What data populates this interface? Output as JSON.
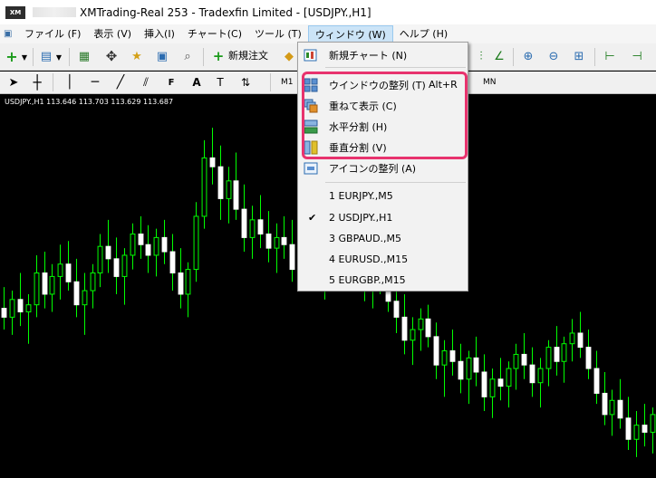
{
  "titlebar": {
    "logo_text": "XM",
    "title": "XMTrading-Real 253 - Tradexfin Limited - [USDJPY.,H1]"
  },
  "menubar": {
    "items": [
      {
        "label": "ファイル (F)"
      },
      {
        "label": "表示 (V)"
      },
      {
        "label": "挿入(I)"
      },
      {
        "label": "チャート(C)"
      },
      {
        "label": "ツール (T)"
      },
      {
        "label": "ウィンドウ (W)"
      },
      {
        "label": "ヘルプ (H)"
      }
    ]
  },
  "toolbar": {
    "new_order_label": "新規注文",
    "timeframes": [
      "M1",
      "MN"
    ]
  },
  "chart": {
    "info": "USDJPY.,H1  113.646 113.703 113.629 113.687",
    "bull_color": "#00ff00",
    "bear_color": "#ffffff",
    "candles": [
      {
        "o": 113.1,
        "h": 113.22,
        "l": 112.98,
        "c": 113.05
      },
      {
        "o": 113.05,
        "h": 113.2,
        "l": 112.95,
        "c": 113.15
      },
      {
        "o": 113.15,
        "h": 113.3,
        "l": 113.0,
        "c": 113.08
      },
      {
        "o": 113.08,
        "h": 113.18,
        "l": 112.9,
        "c": 113.12
      },
      {
        "o": 113.12,
        "h": 113.4,
        "l": 113.05,
        "c": 113.3
      },
      {
        "o": 113.3,
        "h": 113.42,
        "l": 113.1,
        "c": 113.18
      },
      {
        "o": 113.18,
        "h": 113.35,
        "l": 113.08,
        "c": 113.28
      },
      {
        "o": 113.28,
        "h": 113.46,
        "l": 113.15,
        "c": 113.35
      },
      {
        "o": 113.35,
        "h": 113.48,
        "l": 113.2,
        "c": 113.25
      },
      {
        "o": 113.25,
        "h": 113.38,
        "l": 113.05,
        "c": 113.12
      },
      {
        "o": 113.12,
        "h": 113.3,
        "l": 112.95,
        "c": 113.2
      },
      {
        "o": 113.2,
        "h": 113.35,
        "l": 113.1,
        "c": 113.3
      },
      {
        "o": 113.3,
        "h": 113.52,
        "l": 113.22,
        "c": 113.45
      },
      {
        "o": 113.45,
        "h": 113.6,
        "l": 113.3,
        "c": 113.38
      },
      {
        "o": 113.38,
        "h": 113.5,
        "l": 113.18,
        "c": 113.28
      },
      {
        "o": 113.28,
        "h": 113.44,
        "l": 113.12,
        "c": 113.4
      },
      {
        "o": 113.4,
        "h": 113.58,
        "l": 113.32,
        "c": 113.52
      },
      {
        "o": 113.52,
        "h": 113.62,
        "l": 113.38,
        "c": 113.46
      },
      {
        "o": 113.46,
        "h": 113.57,
        "l": 113.3,
        "c": 113.4
      },
      {
        "o": 113.4,
        "h": 113.55,
        "l": 113.28,
        "c": 113.5
      },
      {
        "o": 113.5,
        "h": 113.6,
        "l": 113.35,
        "c": 113.42
      },
      {
        "o": 113.42,
        "h": 113.52,
        "l": 113.2,
        "c": 113.3
      },
      {
        "o": 113.3,
        "h": 113.44,
        "l": 113.1,
        "c": 113.18
      },
      {
        "o": 113.18,
        "h": 113.36,
        "l": 113.05,
        "c": 113.32
      },
      {
        "o": 113.32,
        "h": 113.7,
        "l": 113.25,
        "c": 113.62
      },
      {
        "o": 113.62,
        "h": 114.05,
        "l": 113.55,
        "c": 113.95
      },
      {
        "o": 113.95,
        "h": 114.12,
        "l": 113.8,
        "c": 113.9
      },
      {
        "o": 113.9,
        "h": 114.02,
        "l": 113.6,
        "c": 113.72
      },
      {
        "o": 113.72,
        "h": 113.9,
        "l": 113.58,
        "c": 113.82
      },
      {
        "o": 113.82,
        "h": 113.98,
        "l": 113.6,
        "c": 113.66
      },
      {
        "o": 113.66,
        "h": 113.8,
        "l": 113.42,
        "c": 113.5
      },
      {
        "o": 113.5,
        "h": 113.68,
        "l": 113.38,
        "c": 113.6
      },
      {
        "o": 113.6,
        "h": 113.74,
        "l": 113.44,
        "c": 113.52
      },
      {
        "o": 113.52,
        "h": 113.65,
        "l": 113.36,
        "c": 113.44
      },
      {
        "o": 113.44,
        "h": 113.58,
        "l": 113.3,
        "c": 113.5
      },
      {
        "o": 113.5,
        "h": 113.62,
        "l": 113.38,
        "c": 113.46
      },
      {
        "o": 113.46,
        "h": 113.6,
        "l": 113.25,
        "c": 113.32
      },
      {
        "o": 113.32,
        "h": 113.48,
        "l": 113.2,
        "c": 113.42
      },
      {
        "o": 113.42,
        "h": 113.55,
        "l": 113.3,
        "c": 113.38
      },
      {
        "o": 113.38,
        "h": 113.5,
        "l": 113.22,
        "c": 113.3
      },
      {
        "o": 113.3,
        "h": 113.45,
        "l": 113.15,
        "c": 113.36
      },
      {
        "o": 113.36,
        "h": 113.52,
        "l": 113.24,
        "c": 113.44
      },
      {
        "o": 113.44,
        "h": 113.56,
        "l": 113.3,
        "c": 113.4
      },
      {
        "o": 113.4,
        "h": 113.5,
        "l": 113.28,
        "c": 113.34
      },
      {
        "o": 113.34,
        "h": 113.46,
        "l": 113.2,
        "c": 113.28
      },
      {
        "o": 113.28,
        "h": 113.4,
        "l": 113.14,
        "c": 113.22
      },
      {
        "o": 113.22,
        "h": 113.35,
        "l": 113.1,
        "c": 113.3
      },
      {
        "o": 113.3,
        "h": 113.42,
        "l": 113.18,
        "c": 113.24
      },
      {
        "o": 113.24,
        "h": 113.36,
        "l": 113.08,
        "c": 113.14
      },
      {
        "o": 113.14,
        "h": 113.26,
        "l": 112.96,
        "c": 113.05
      },
      {
        "o": 113.05,
        "h": 113.18,
        "l": 112.84,
        "c": 112.92
      },
      {
        "o": 112.92,
        "h": 113.05,
        "l": 112.78,
        "c": 112.98
      },
      {
        "o": 112.98,
        "h": 113.1,
        "l": 112.86,
        "c": 113.04
      },
      {
        "o": 113.04,
        "h": 113.12,
        "l": 112.88,
        "c": 112.94
      },
      {
        "o": 112.94,
        "h": 113.02,
        "l": 112.7,
        "c": 112.78
      },
      {
        "o": 112.78,
        "h": 112.92,
        "l": 112.6,
        "c": 112.86
      },
      {
        "o": 112.86,
        "h": 112.98,
        "l": 112.72,
        "c": 112.8
      },
      {
        "o": 112.8,
        "h": 112.9,
        "l": 112.62,
        "c": 112.7
      },
      {
        "o": 112.7,
        "h": 112.86,
        "l": 112.56,
        "c": 112.82
      },
      {
        "o": 112.82,
        "h": 112.94,
        "l": 112.66,
        "c": 112.74
      },
      {
        "o": 112.74,
        "h": 112.84,
        "l": 112.52,
        "c": 112.6
      },
      {
        "o": 112.6,
        "h": 112.76,
        "l": 112.48,
        "c": 112.7
      },
      {
        "o": 112.7,
        "h": 112.82,
        "l": 112.58,
        "c": 112.66
      },
      {
        "o": 112.66,
        "h": 112.8,
        "l": 112.54,
        "c": 112.76
      },
      {
        "o": 112.76,
        "h": 112.9,
        "l": 112.64,
        "c": 112.84
      },
      {
        "o": 112.84,
        "h": 112.96,
        "l": 112.7,
        "c": 112.78
      },
      {
        "o": 112.78,
        "h": 112.88,
        "l": 112.6,
        "c": 112.68
      },
      {
        "o": 112.68,
        "h": 112.82,
        "l": 112.54,
        "c": 112.76
      },
      {
        "o": 112.76,
        "h": 112.92,
        "l": 112.66,
        "c": 112.88
      },
      {
        "o": 112.88,
        "h": 113.0,
        "l": 112.72,
        "c": 112.8
      },
      {
        "o": 112.8,
        "h": 112.94,
        "l": 112.68,
        "c": 112.9
      },
      {
        "o": 112.9,
        "h": 113.04,
        "l": 112.8,
        "c": 112.96
      },
      {
        "o": 112.96,
        "h": 113.08,
        "l": 112.82,
        "c": 112.88
      },
      {
        "o": 112.88,
        "h": 112.98,
        "l": 112.7,
        "c": 112.76
      },
      {
        "o": 112.76,
        "h": 112.86,
        "l": 112.56,
        "c": 112.62
      },
      {
        "o": 112.62,
        "h": 112.74,
        "l": 112.44,
        "c": 112.5
      },
      {
        "o": 112.5,
        "h": 112.64,
        "l": 112.38,
        "c": 112.58
      },
      {
        "o": 112.58,
        "h": 112.7,
        "l": 112.42,
        "c": 112.48
      },
      {
        "o": 112.48,
        "h": 112.6,
        "l": 112.3,
        "c": 112.36
      },
      {
        "o": 112.36,
        "h": 112.52,
        "l": 112.26,
        "c": 112.44
      },
      {
        "o": 112.44,
        "h": 112.56,
        "l": 112.32,
        "c": 112.4
      },
      {
        "o": 112.4,
        "h": 112.54,
        "l": 112.28,
        "c": 112.5
      }
    ]
  },
  "window_menu": {
    "items": [
      {
        "label": "新規チャート (N)",
        "shortcut": "",
        "icon": "new-chart-icon"
      },
      {
        "label": "ウインドウの整列 (T)",
        "shortcut": "Alt+R",
        "icon": "tile-windows-icon"
      },
      {
        "label": "重ねて表示 (C)",
        "shortcut": "",
        "icon": "cascade-icon"
      },
      {
        "label": "水平分割 (H)",
        "shortcut": "",
        "icon": "tile-horizontal-icon"
      },
      {
        "label": "垂直分割 (V)",
        "shortcut": "",
        "icon": "tile-vertical-icon"
      },
      {
        "label": "アイコンの整列 (A)",
        "shortcut": "",
        "icon": "arrange-icons-icon"
      }
    ],
    "windows": [
      {
        "label": "1 EURJPY.,M5",
        "checked": false
      },
      {
        "label": "2 USDJPY.,H1",
        "checked": true
      },
      {
        "label": "3 GBPAUD.,M5",
        "checked": false
      },
      {
        "label": "4 EURUSD.,M15",
        "checked": false
      },
      {
        "label": "5 EURGBP.,M15",
        "checked": false
      }
    ],
    "check_mark": "✔",
    "highlight_color": "#e8336e"
  }
}
